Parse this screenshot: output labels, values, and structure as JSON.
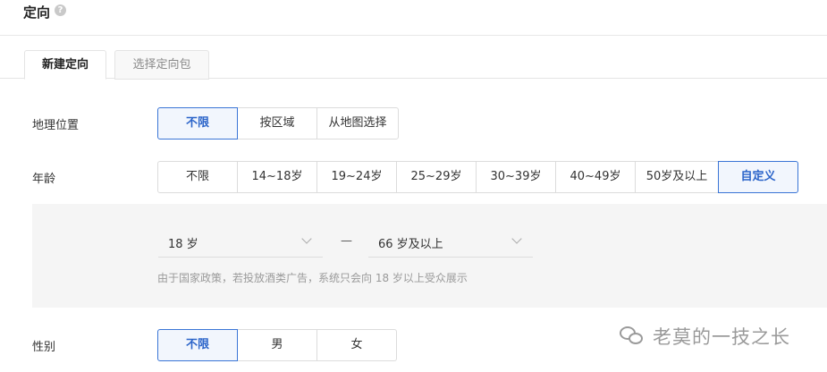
{
  "header": {
    "title": "定向",
    "help_icon": "question-circle-icon",
    "help_glyph": "?"
  },
  "tabs": [
    {
      "label": "新建定向",
      "active": true
    },
    {
      "label": "选择定向包",
      "active": false
    }
  ],
  "geo": {
    "label": "地理位置",
    "options": [
      "不限",
      "按区域",
      "从地图选择"
    ],
    "selected": "不限"
  },
  "age": {
    "label": "年龄",
    "options": [
      "不限",
      "14~18岁",
      "19~24岁",
      "25~29岁",
      "30~39岁",
      "40~49岁",
      "50岁及以上",
      "自定义"
    ],
    "selected": "自定义",
    "custom": {
      "from": "18 岁",
      "separator": "—",
      "to": "66 岁及以上",
      "notice": "由于国家政策，若投放酒类广告，系统只会向 18 岁以上受众展示"
    }
  },
  "gender": {
    "label": "性别",
    "options": [
      "不限",
      "男",
      "女"
    ],
    "selected": "不限"
  },
  "watermark": {
    "text": "老莫的一技之长",
    "icon": "wechat-icon"
  },
  "colors": {
    "accent": "#2b64c9",
    "accent_border": "#3a75d6",
    "panel_bg": "#f5f5f5",
    "muted_text": "#9a9a9a"
  }
}
